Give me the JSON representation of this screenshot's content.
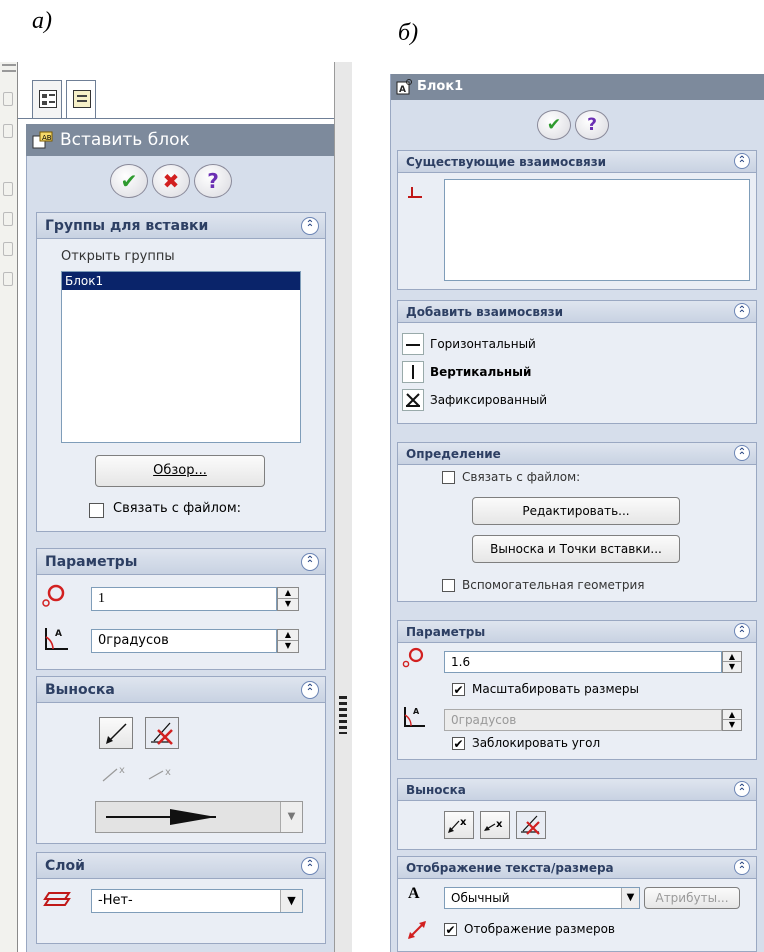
{
  "captions": {
    "a": "а)",
    "b": "б)"
  },
  "panel_a": {
    "title": "Вставить блок",
    "buttons": {
      "ok": "✔",
      "cancel": "✖",
      "help": "?"
    },
    "groups_section": {
      "title": "Группы для вставки",
      "open_groups_label": "Открыть группы",
      "list_items": [
        "Блок1"
      ],
      "browse_button": "Обзор...",
      "link_to_file": "Связать с файлом:"
    },
    "params_section": {
      "title": "Параметры",
      "scale_value": "1",
      "angle_value": "0градусов"
    },
    "leader_section": {
      "title": "Выноска"
    },
    "layer_section": {
      "title": "Слой",
      "layer_value": "-Нет-"
    }
  },
  "panel_b": {
    "title": "Блок1",
    "buttons": {
      "ok": "✔",
      "help": "?"
    },
    "existing_relations": {
      "title": "Существующие взаимосвязи"
    },
    "add_relations": {
      "title": "Добавить взаимосвязи",
      "items": [
        "Горизонтальный",
        "Вертикальный",
        "Зафиксированный"
      ]
    },
    "definition": {
      "title": "Определение",
      "link_to_file": "Связать с файлом:",
      "edit_button": "Редактировать...",
      "leader_button": "Выноска и Точки вставки...",
      "construction_geometry": "Вспомогательная геометрия"
    },
    "params": {
      "title": "Параметры",
      "scale_value": "1.6",
      "scale_dimensions": "Масштабировать размеры",
      "angle_value": "0градусов",
      "lock_angle": "Заблокировать угол"
    },
    "leader": {
      "title": "Выноска"
    },
    "text_display": {
      "title": "Отображение текста/размера",
      "font_value": "Обычный",
      "attributes_button": "Атрибуты...",
      "show_dimensions": "Отображение размеров"
    }
  },
  "colors": {
    "title_bar": "#7d8a9c",
    "panel_bg": "#d6deeb",
    "group_header_text": "#2d3f63",
    "ok_green": "#2e9a2e",
    "cancel_red": "#d22020",
    "help_purple": "#6b2fb3"
  }
}
